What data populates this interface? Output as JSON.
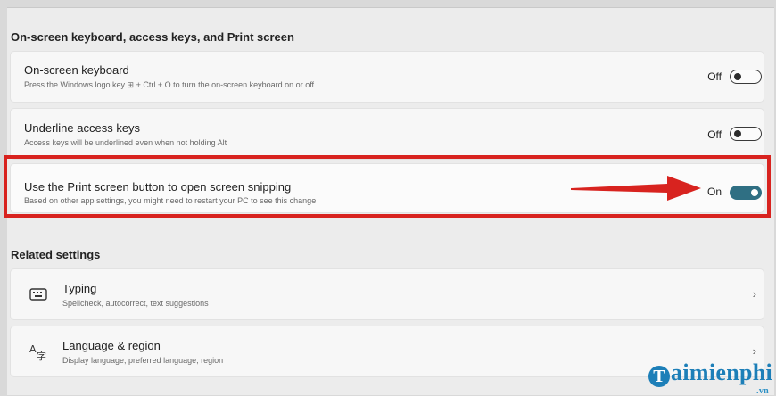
{
  "sections": {
    "keyboard_title": "On-screen keyboard, access keys, and Print screen",
    "related_title": "Related settings"
  },
  "settings": [
    {
      "title": "On-screen keyboard",
      "subtitle": "Press the Windows logo key ⊞ + Ctrl + O to turn the on-screen keyboard on or off",
      "state": "Off"
    },
    {
      "title": "Underline access keys",
      "subtitle": "Access keys will be underlined even when not holding Alt",
      "state": "Off"
    },
    {
      "title": "Use the Print screen button to open screen snipping",
      "subtitle": "Based on other app settings, you might need to restart your PC to see this change",
      "state": "On"
    }
  ],
  "related": [
    {
      "title": "Typing",
      "subtitle": "Spellcheck, autocorrect, text suggestions",
      "icon": "keyboard-icon"
    },
    {
      "title": "Language & region",
      "subtitle": "Display language, preferred language, region",
      "icon": "language-icon"
    }
  ],
  "watermark": {
    "initial": "T",
    "text": "aimienphi",
    "suffix": ".vn"
  },
  "colors": {
    "toggle_on": "#2f6f83",
    "highlight": "#d8231f",
    "watermark": "#1d7fb8"
  }
}
